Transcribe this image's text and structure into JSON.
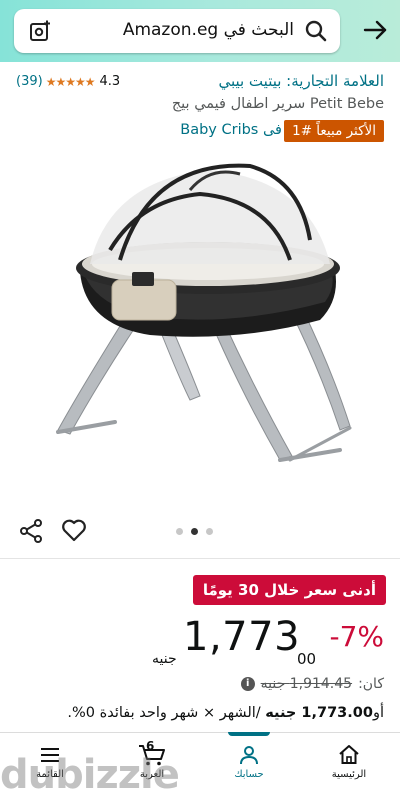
{
  "header": {
    "search_text": "البحث في Amazon.eg",
    "colors": {
      "gradient_start": "#86e3d8",
      "gradient_end": "#b9ecd9"
    }
  },
  "product": {
    "rating_count": "(39)",
    "rating_stars": "★★★★★",
    "rating_score": "4.3",
    "brand": "العلامة التجارية: بيتيت بيبي",
    "title": "Petit Bebe سرير اطفال فيمي بيج",
    "best_seller_badge": "الأكثر مبيعاً #1",
    "best_seller_category": "فى Baby Cribs",
    "image_alt": "baby-crib-image",
    "carousel_dots": 3,
    "carousel_active": 2
  },
  "pricing": {
    "low_price_badge": "أدنى سعر خلال 30 يومًا",
    "discount": "-7%",
    "price_whole": "1,773",
    "price_fraction": "00",
    "currency": "جنيه",
    "was_label": "كان:",
    "was_value": "1,914.45 جنيه",
    "installment_prefix": "أو",
    "installment_amount": "1,773.00 جنيه",
    "installment_rest": "/الشهر × شهر واحد بفائدة 0%."
  },
  "nav": {
    "home": "الرئيسية",
    "account": "حسابك",
    "cart": "العربة",
    "cart_count": "6",
    "menu": "القائمة"
  },
  "watermark": "dubizzle",
  "colors": {
    "link": "#007185",
    "deal_red": "#cc0c39",
    "best_seller_orange": "#cc5500",
    "star": "#de7921"
  }
}
